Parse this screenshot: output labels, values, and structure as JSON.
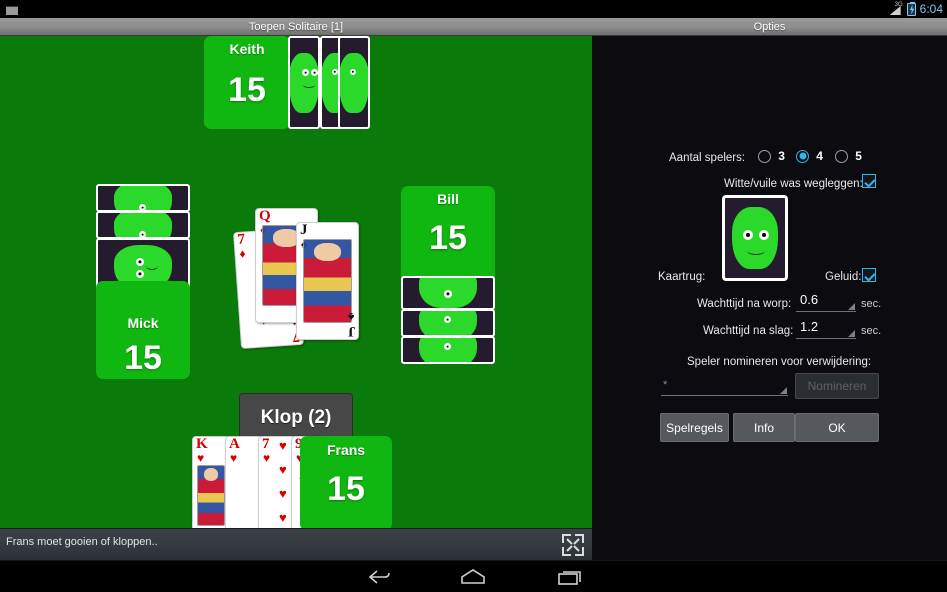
{
  "android": {
    "clock": "6:04",
    "signal_label": "3G",
    "app_icon_name": "app-icon",
    "nav": {
      "back": "back",
      "home": "home",
      "recents": "recent-apps"
    }
  },
  "windows": {
    "game_title": "Toepen Solitaire [1]",
    "options_title": "Opties"
  },
  "game": {
    "background_color": "#0a7a0a",
    "panel_color": "#11b711",
    "players": [
      {
        "name": "Keith",
        "score": "15",
        "position": "top",
        "facedown_cards": 3
      },
      {
        "name": "Mick",
        "score": "15",
        "position": "left",
        "facedown_cards": 3
      },
      {
        "name": "Bill",
        "score": "15",
        "position": "right",
        "facedown_cards": 3
      },
      {
        "name": "Frans",
        "score": "15",
        "position": "bottom",
        "facedown_cards": 0
      }
    ],
    "hand": [
      {
        "rank": "K",
        "suit": "♥",
        "color": "red",
        "court": true
      },
      {
        "rank": "A",
        "suit": "♥",
        "color": "red",
        "court": false
      },
      {
        "rank": "7",
        "suit": "♥",
        "color": "red",
        "court": false
      },
      {
        "rank": "9",
        "suit": "♥",
        "color": "red",
        "court": false
      }
    ],
    "trick": [
      {
        "rank": "7",
        "suit": "♦",
        "color": "red",
        "court": false
      },
      {
        "rank": "Q",
        "suit": "♦",
        "color": "red",
        "court": true
      },
      {
        "rank": "J",
        "suit": "♠",
        "color": "black",
        "court": true
      }
    ],
    "klop_button": "Klop (2)",
    "status_text": "Frans moet gooien of kloppen..",
    "expand_icon": "fullscreen-icon"
  },
  "options": {
    "players_label": "Aantal spelers:",
    "players_choices": [
      "3",
      "4",
      "5"
    ],
    "players_selected": "4",
    "white_dirty_label": "Witte/vuile was wegleggen:",
    "white_dirty_checked": true,
    "cardback_label": "Kaartrug:",
    "sound_label": "Geluid:",
    "sound_checked": true,
    "wait_throw_label": "Wachttijd na worp:",
    "wait_throw_value": "0.6",
    "wait_throw_unit": "sec.",
    "wait_trick_label": "Wachttijd na slag:",
    "wait_trick_value": "1.2",
    "wait_trick_unit": "sec.",
    "nominate_label": "Speler nomineren voor verwijdering:",
    "nominate_select_value": "*",
    "nominate_button": "Nomineren",
    "nominate_button_enabled": false,
    "rules_button": "Spelregels",
    "info_button": "Info",
    "ok_button": "OK",
    "accent_color": "#33b5e5"
  }
}
